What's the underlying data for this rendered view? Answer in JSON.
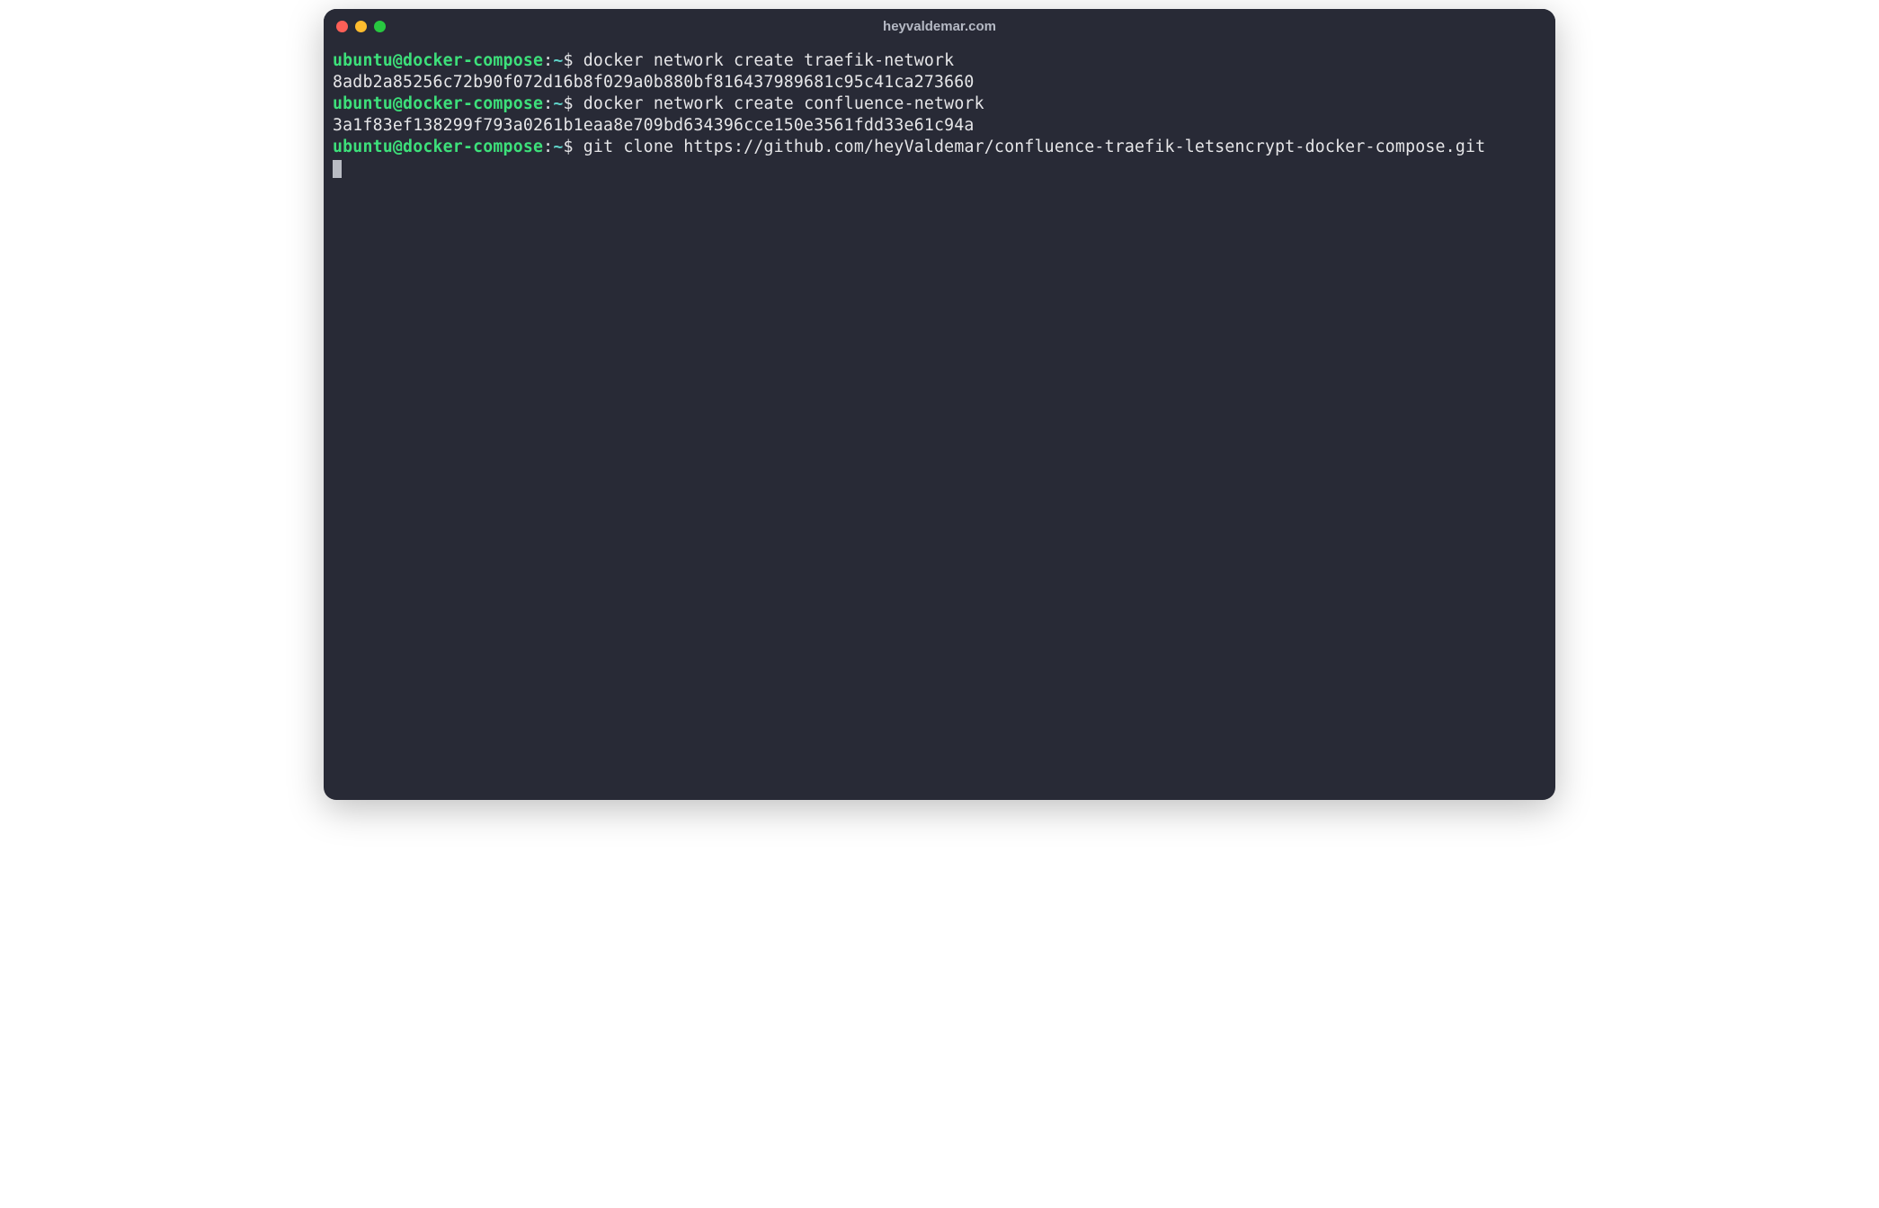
{
  "window": {
    "title": "heyvaldemar.com"
  },
  "prompt": {
    "user_host": "ubuntu@docker-compose",
    "colon": ":",
    "path": "~",
    "symbol": "$"
  },
  "lines": [
    {
      "type": "cmd",
      "text": "docker network create traefik-network"
    },
    {
      "type": "output",
      "text": "8adb2a85256c72b90f072d16b8f029a0b880bf816437989681c95c41ca273660"
    },
    {
      "type": "cmd",
      "text": "docker network create confluence-network"
    },
    {
      "type": "output",
      "text": "3a1f83ef138299f793a0261b1eaa8e709bd634396cce150e3561fdd33e61c94a"
    },
    {
      "type": "cmd",
      "text": "git clone https://github.com/heyValdemar/confluence-traefik-letsencrypt-docker-compose.git"
    }
  ],
  "colors": {
    "bg": "#282a36",
    "user": "#3de07a",
    "path": "#5ed1c7",
    "text": "#e6e6e8"
  }
}
